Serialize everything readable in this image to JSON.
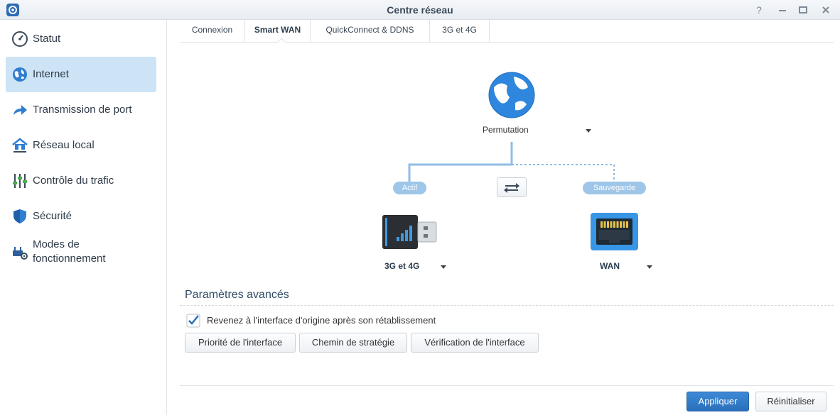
{
  "window": {
    "title": "Centre réseau"
  },
  "sidebar": {
    "items": [
      {
        "label": "Statut",
        "icon": "gauge-icon"
      },
      {
        "label": "Internet",
        "icon": "globe-icon",
        "active": true
      },
      {
        "label": "Transmission de port",
        "icon": "forward-arrow-icon"
      },
      {
        "label": "Réseau local",
        "icon": "home-network-icon"
      },
      {
        "label": "Contrôle du trafic",
        "icon": "sliders-icon"
      },
      {
        "label": "Sécurité",
        "icon": "shield-icon"
      },
      {
        "label_line1": "Modes de",
        "label_line2": "fonctionnement",
        "icon": "router-gear-icon"
      }
    ]
  },
  "tabs": [
    {
      "label": "Connexion"
    },
    {
      "label": "Smart WAN",
      "active": true
    },
    {
      "label": "QuickConnect & DDNS"
    },
    {
      "label": "3G et 4G"
    }
  ],
  "diagram": {
    "mode_label": "Permutation",
    "active_pill": "Actif",
    "backup_pill": "Sauvegarde",
    "left_interface": "3G et 4G",
    "right_interface": "WAN"
  },
  "advanced": {
    "title": "Paramètres avancés",
    "checkbox_label": "Revenez à l'interface d'origine après son rétablissement",
    "checkbox_checked": true,
    "buttons": {
      "priority": "Priorité de l'interface",
      "strategy": "Chemin de stratégie",
      "verification": "Vérification de l'interface"
    }
  },
  "footer": {
    "apply": "Appliquer",
    "reset": "Réinitialiser"
  },
  "colors": {
    "accent": "#2a6fba",
    "active_sidebar": "#cce4f6",
    "pill": "#9ec6e8",
    "line": "#8fbde6"
  }
}
